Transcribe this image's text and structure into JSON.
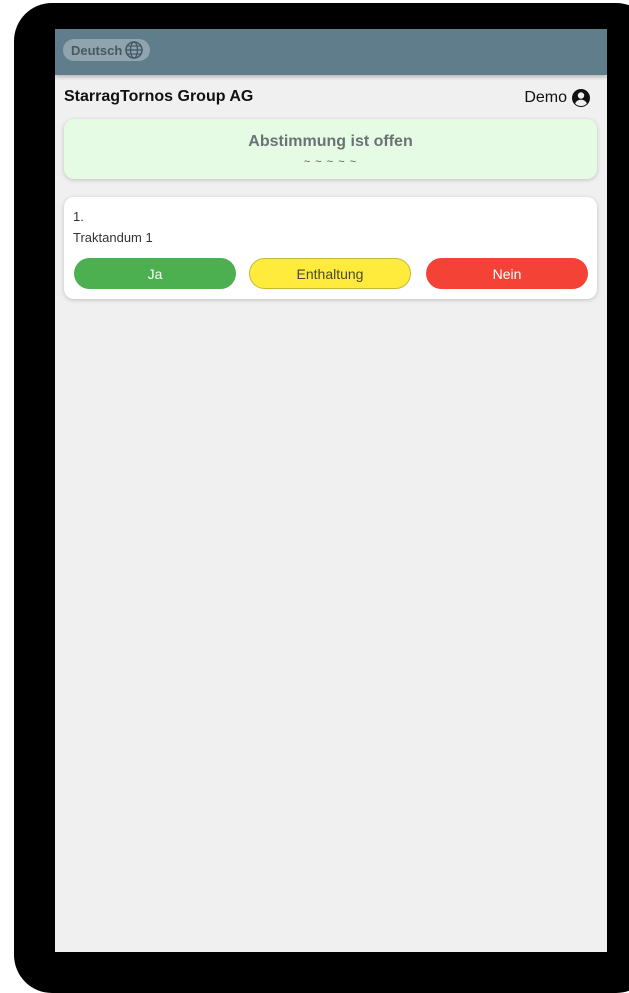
{
  "topbar": {
    "language_label": "Deutsch",
    "language_icon": "globe-icon"
  },
  "header": {
    "company_name": "StarragTornos Group AG",
    "user_name": "Demo",
    "user_icon": "user-circle-icon"
  },
  "status": {
    "title": "Abstimmung ist offen",
    "subtitle": "~ ~ ~ ~ ~",
    "color": "#e6fbe3"
  },
  "agenda_items": [
    {
      "number": "1.",
      "title": "Traktandum 1",
      "buttons": {
        "yes": "Ja",
        "abstain": "Enthaltung",
        "no": "Nein"
      }
    }
  ],
  "colors": {
    "topbar": "#607d8b",
    "yes": "#4caf50",
    "abstain": "#ffeb3b",
    "no": "#f44336"
  }
}
